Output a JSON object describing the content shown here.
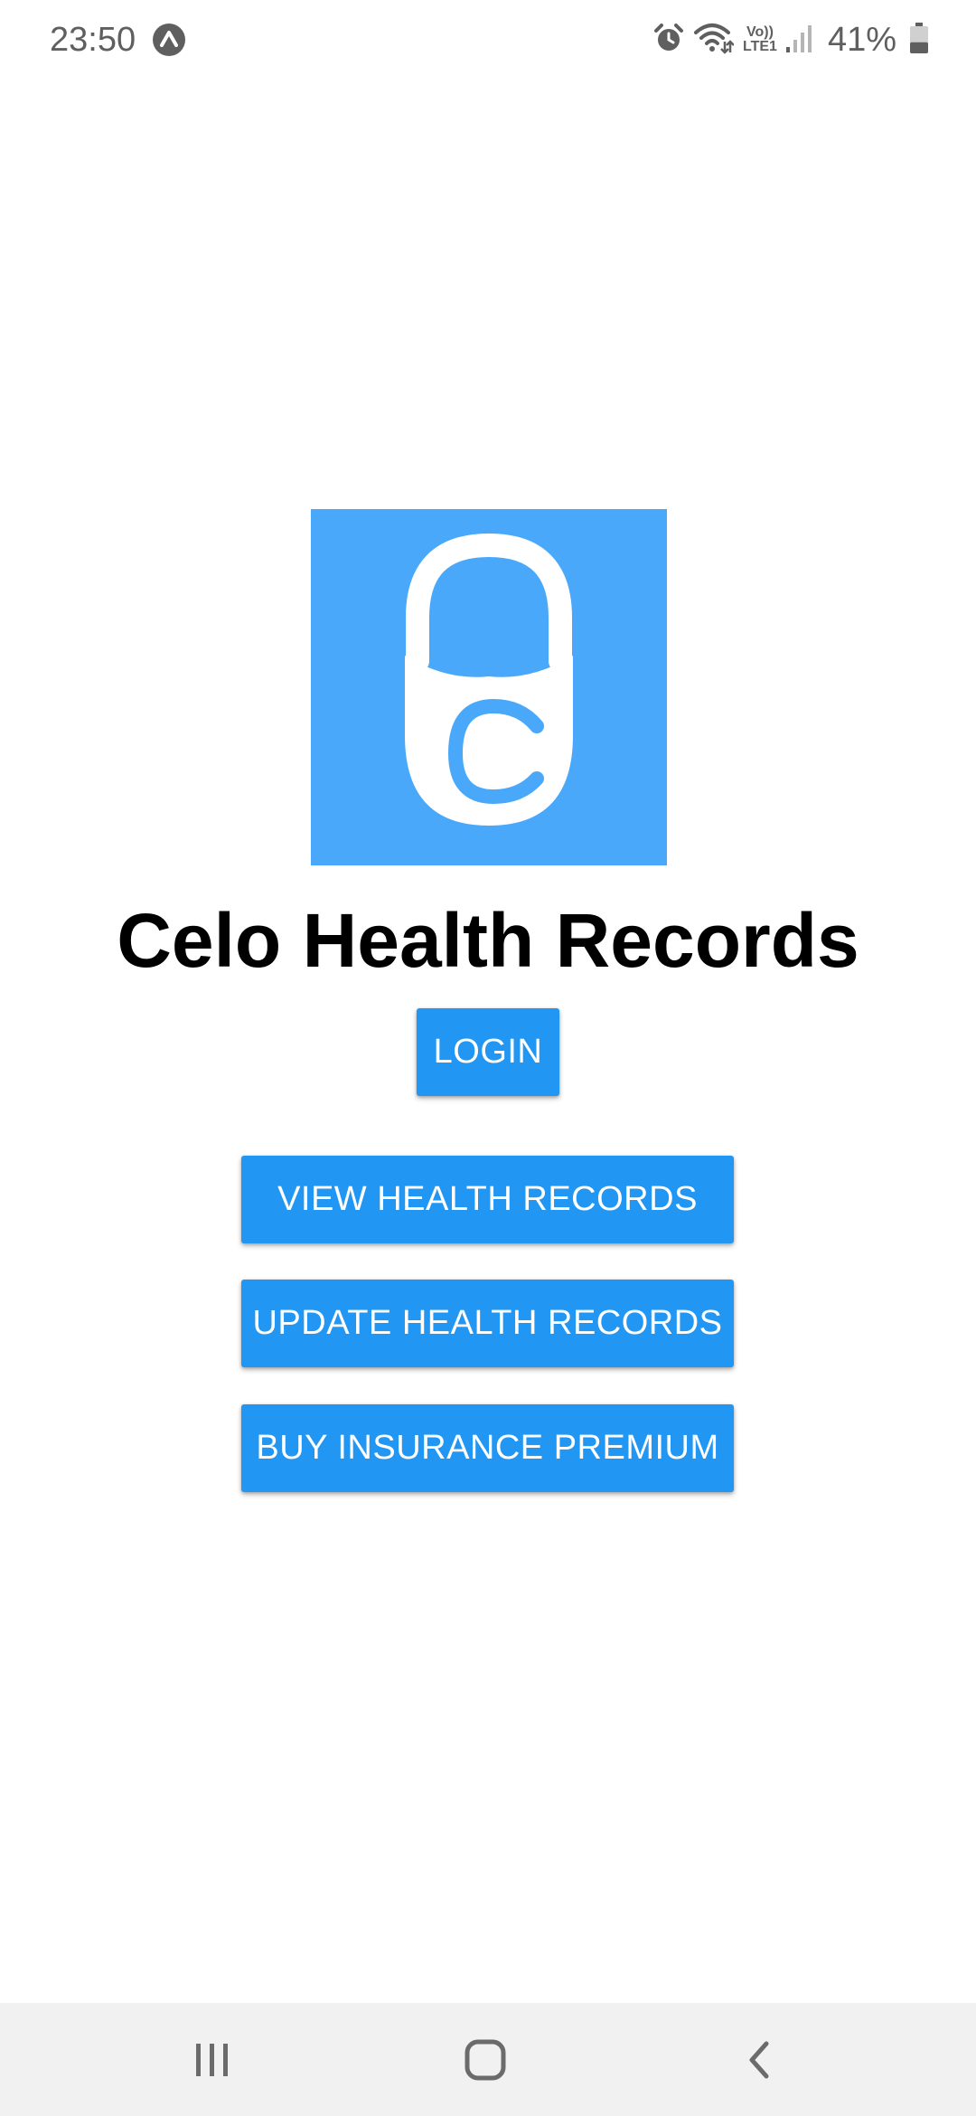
{
  "status_bar": {
    "time": "23:50",
    "notification_icon": "app-notification-icon",
    "alarm_icon": "alarm-icon",
    "wifi_icon": "wifi-icon",
    "volte_top": "Vo))",
    "volte_bottom": "LTE1",
    "signal_icon": "signal-icon",
    "battery_percent": "41%",
    "battery_level": 0.41,
    "battery_icon": "battery-icon"
  },
  "app": {
    "logo_icon": "padlock-c-logo",
    "logo_color": "#4aa8fa",
    "title": "Celo Health Records"
  },
  "buttons": {
    "login": "LOGIN",
    "view_records": "VIEW HEALTH RECORDS",
    "update_records": "UPDATE HEALTH RECORDS",
    "buy_insurance": "BUY INSURANCE PREMIUM",
    "color": "#2196f3"
  },
  "nav_bar": {
    "recents_icon": "recents-icon",
    "home_icon": "home-icon",
    "back_icon": "back-icon"
  }
}
